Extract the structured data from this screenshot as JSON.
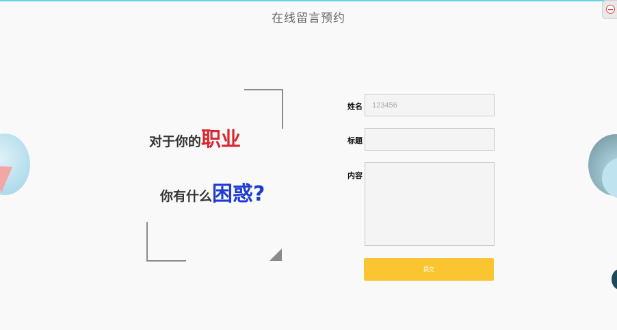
{
  "page": {
    "title": "在线留言预约"
  },
  "slogan": {
    "line1_prefix": "对于你的",
    "line1_highlight": "职业",
    "line2_prefix": "你有什么",
    "line2_highlight": "困惑?"
  },
  "form": {
    "name_label": "姓名",
    "name_value": "123456",
    "title_label": "标题",
    "title_value": "",
    "content_label": "内容",
    "content_value": "",
    "submit_label": "提交"
  },
  "colors": {
    "highlight_red": "#d9252f",
    "highlight_blue": "#1f3bd2",
    "submit_bg": "#fbc531"
  },
  "icons": {
    "corner_button": "minus-circle-icon"
  }
}
